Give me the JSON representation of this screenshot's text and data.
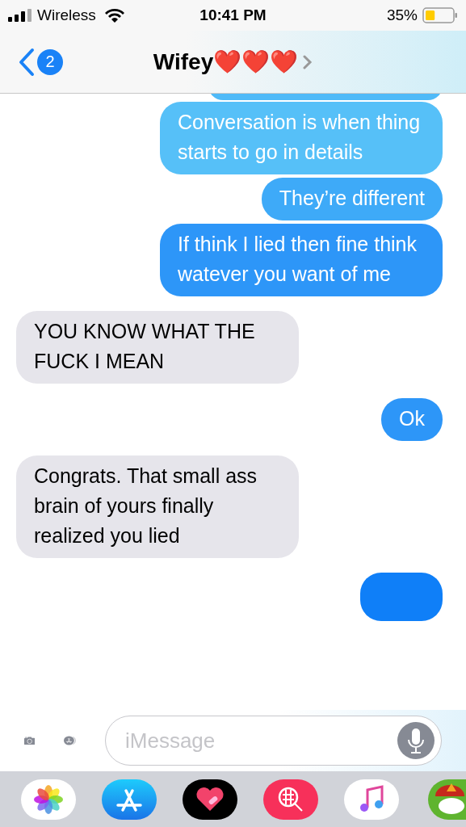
{
  "status_bar": {
    "carrier": "Wireless",
    "time": "10:41 PM",
    "battery": "35%"
  },
  "nav": {
    "unread_count": "2",
    "title": "Wifey❤️❤️❤️"
  },
  "messages": [
    {
      "kind": "sent",
      "text": "Conversation is when thing starts to go in details"
    },
    {
      "kind": "sent",
      "text": "They’re different"
    },
    {
      "kind": "sent",
      "text": "If think I lied then fine think watever you want of me"
    },
    {
      "kind": "received",
      "text": "YOU KNOW WHAT THE FUCK I MEAN"
    },
    {
      "kind": "sent",
      "text": "Ok"
    },
    {
      "kind": "received",
      "text": "Congrats. That small ass brain of yours finally realized you lied"
    }
  ],
  "composer": {
    "placeholder": "iMessage"
  }
}
